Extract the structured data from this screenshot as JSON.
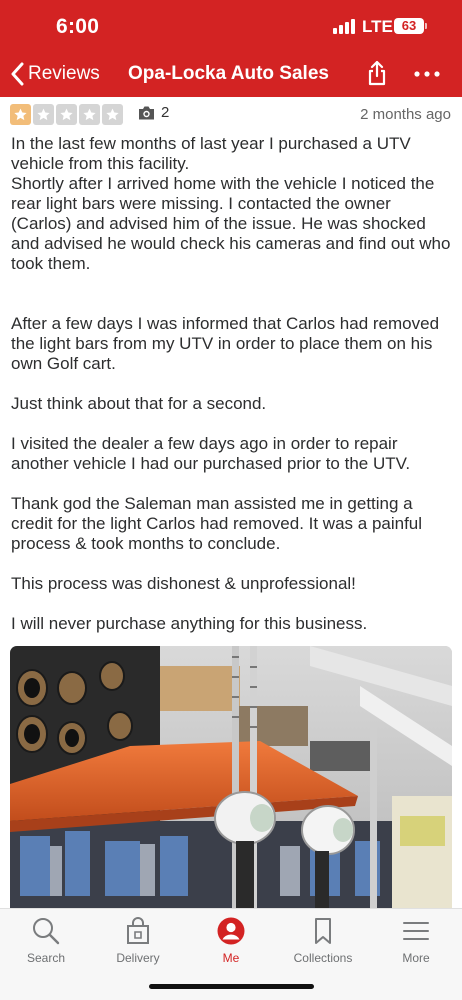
{
  "status_bar": {
    "time": "6:00",
    "network": "LTE",
    "battery": "63"
  },
  "nav": {
    "back_label": "Reviews",
    "title": "Opa-Locka Auto Sales",
    "share_icon": "share-icon",
    "more_icon": "more-horizontal-icon"
  },
  "review": {
    "rating": 1,
    "rating_max": 5,
    "photo_count": "2",
    "date": "2 months ago",
    "paragraphs": [
      "In the last few months of last year I purchased a UTV vehicle from this facility.\nShortly after I arrived home with the vehicle I noticed the rear light bars  were missing. I contacted the owner (Carlos) and advised him of the issue. He was shocked and advised he would check his cameras and find out who took them.",
      "After a few days I was informed that Carlos had removed the light bars from my UTV in order to place them on his own Golf cart.",
      "Just think about that for a second.",
      "I visited the dealer a few days ago in order to repair another vehicle I had our purchased prior to the UTV.",
      "Thank god the Saleman man assisted me in getting a credit for the light Carlos had removed. It was a painful process & took months to conclude.",
      "This process was dishonest & unprofessional!",
      "I will never purchase anything for this business."
    ]
  },
  "tab_bar": {
    "tabs": [
      {
        "label": "Search",
        "icon": "search-icon",
        "active": false
      },
      {
        "label": "Delivery",
        "icon": "delivery-bag-icon",
        "active": false
      },
      {
        "label": "Me",
        "icon": "profile-icon",
        "active": true
      },
      {
        "label": "Collections",
        "icon": "bookmark-icon",
        "active": false
      },
      {
        "label": "More",
        "icon": "menu-icon",
        "active": false
      }
    ]
  },
  "colors": {
    "brand_red": "#d32323",
    "star_filled": "#f2bd79",
    "star_empty": "#d5d5d5",
    "golf_cart_roof": "#e4622a"
  }
}
